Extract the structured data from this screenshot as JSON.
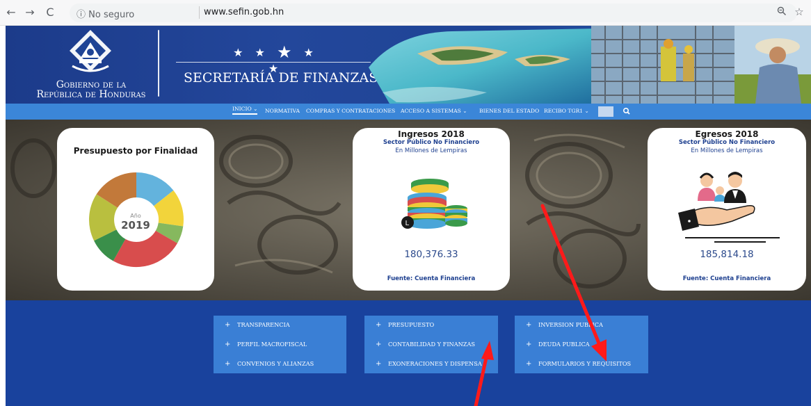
{
  "browser": {
    "back_icon": "arrow-left-icon",
    "forward_icon": "arrow-right-icon",
    "reload_icon": "reload-icon",
    "security_label": "ⓘ No seguro",
    "domain": "www.sefin.gob.hn"
  },
  "header": {
    "gov_line1": "Gobierno de la",
    "gov_line2": "República de Honduras",
    "title": "SECRETARÍA DE FINANZAS"
  },
  "nav": {
    "items": [
      "INICIO ⌄",
      "NORMATIVA",
      "COMPRAS Y CONTRATACIONES",
      "ACCESO A SISTEMAS ⌄",
      "BIENES DEL ESTADO",
      "RECIBO TGR1 ⌄"
    ]
  },
  "cards": {
    "presupuesto": {
      "title": "Presupuesto por Finalidad",
      "year_label": "Año",
      "year": "2019"
    },
    "ingresos": {
      "title": "Ingresos 2018",
      "subtitle": "Sector Público No Financiero",
      "unit": "En Millones de Lempiras",
      "value": "180,376.33",
      "source": "Fuente: Cuenta Financiera"
    },
    "egresos": {
      "title": "Egresos 2018",
      "subtitle": "Sector Público No Financiero",
      "unit": "En Millones de Lempiras",
      "value": "185,814.18",
      "source": "Fuente: Cuenta Financiera"
    }
  },
  "menus": [
    {
      "items": [
        "TRANSPARENCIA",
        "PERFIL MACROFISCAL",
        "CONVENIOS Y ALIANZAS"
      ]
    },
    {
      "items": [
        "PRESUPUESTO",
        "CONTABILIDAD Y FINANZAS",
        "EXONERACIONES Y DISPENSA"
      ]
    },
    {
      "items": [
        "INVERSION PUBLICA",
        "DEUDA PUBLICA",
        "FORMULARIOS Y REQUISITOS"
      ]
    }
  ],
  "colors": {
    "header_blue": "#1f4495",
    "nav_blue": "#3b86d8",
    "section_blue": "#19429d",
    "menu_box": "#3a7fd5",
    "annotation_red": "#ff1a1a"
  }
}
